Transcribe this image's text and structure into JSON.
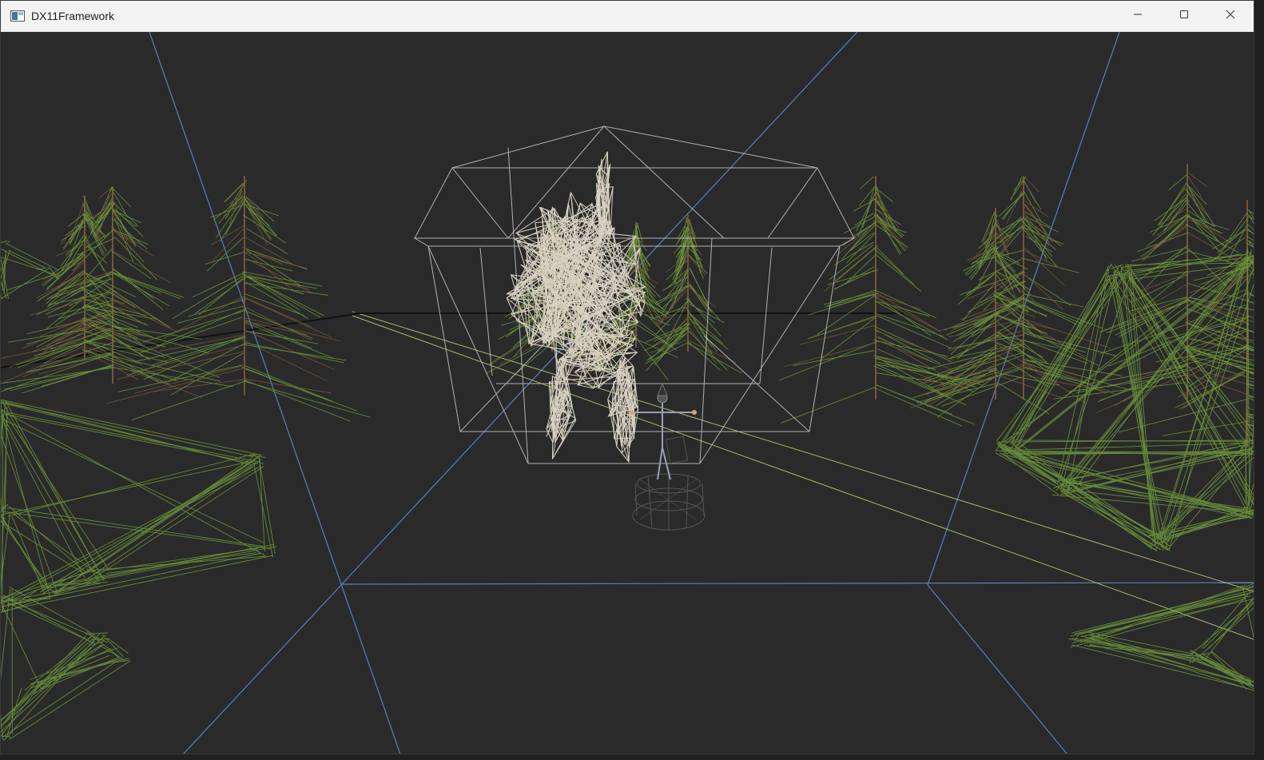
{
  "window": {
    "title": "DX11Framework",
    "app_icon": "app-window-icon",
    "controls": {
      "minimize": "minimize-icon",
      "maximize": "maximize-icon",
      "close": "close-icon"
    }
  },
  "scene": {
    "background": "#2a2a2a",
    "grid_color": "#5b7fb8",
    "tree_color": "#6f9a3c",
    "trunk_color": "#7a5a3a",
    "elephant_color": "#d8d0c0",
    "box_color": "#c8c8c8",
    "character_color": "#8a8a9a"
  }
}
